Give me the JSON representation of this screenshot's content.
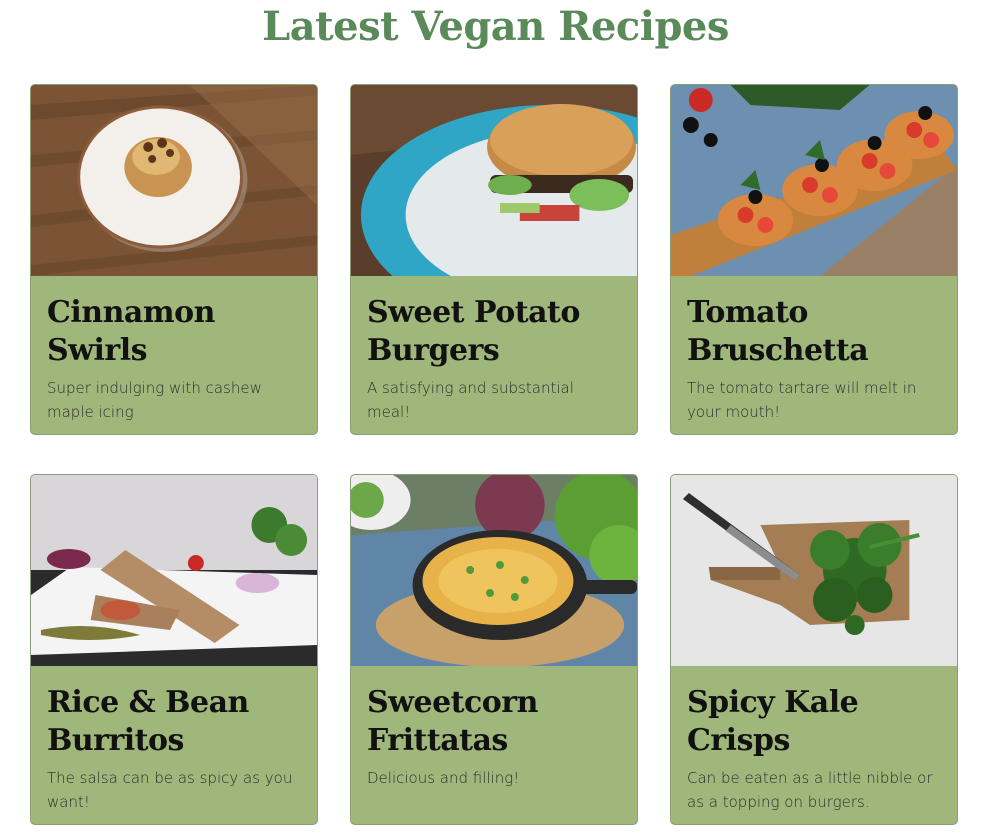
{
  "page": {
    "heading": "Latest Vegan Recipes"
  },
  "colors": {
    "heading": "#5b8a5a",
    "card_background": "#a0b77c"
  },
  "recipes": [
    {
      "title": "Cinnamon Swirls",
      "description": "Super indulging with cashew maple icing",
      "image": "cinnamon-swirl-on-plate"
    },
    {
      "title": "Sweet Potato Burgers",
      "description": "A satisfying and substantial meal!",
      "image": "burger-on-blue-plate"
    },
    {
      "title": "Tomato Bruschetta",
      "description": "The tomato tartare will melt in your mouth!",
      "image": "bruschetta-on-board"
    },
    {
      "title": "Rice & Bean Burritos",
      "description": "The salsa can be as spicy as you want!",
      "image": "burrito-wraps-on-plate"
    },
    {
      "title": "Sweetcorn Frittatas",
      "description": "Delicious and filling!",
      "image": "frittata-in-skillet"
    },
    {
      "title": "Spicy Kale Crisps",
      "description": "Can be eaten as a little nibble or as a topping on burgers.",
      "image": "kale-and-knife-on-board"
    }
  ]
}
